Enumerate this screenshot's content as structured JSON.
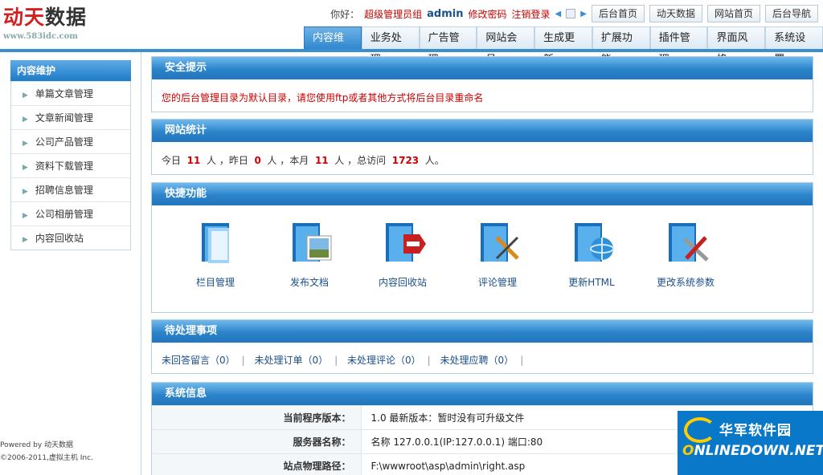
{
  "logo": {
    "text_red": "动天",
    "text_dark": "数据",
    "url": "www.583idc.com"
  },
  "topbar": {
    "greeting": "你好：",
    "role": "超级管理员组",
    "username": "admin",
    "change_password": "修改密码",
    "logout": "注销登录",
    "buttons": [
      "后台首页",
      "动天数据",
      "网站首页",
      "后台导航"
    ]
  },
  "menu": {
    "tabs": [
      "内容维护",
      "业务处理",
      "广告管理",
      "网站会员",
      "生成更新",
      "扩展功能",
      "插件管理",
      "界面风格",
      "系统设置"
    ],
    "active": "内容维护"
  },
  "sidebar": {
    "title": "内容维护",
    "items": [
      "单篇文章管理",
      "文章新闻管理",
      "公司产品管理",
      "资料下载管理",
      "招聘信息管理",
      "公司相册管理",
      "内容回收站"
    ],
    "footer_line1": "Powered by 动天数据",
    "footer_line2": "©2006-2011,虚拟主机 Inc."
  },
  "security": {
    "title": "安全提示",
    "message": "您的后台管理目录为默认目录，请您使用ftp或者其他方式将后台目录重命名"
  },
  "stats": {
    "title": "网站统计",
    "today_label": "今日",
    "today": "11",
    "yesterday_label": "人 ，昨日",
    "yesterday": "0",
    "month_label": "人 ，本月",
    "month": "11",
    "total_label": "人 ，总访问",
    "total": "1723",
    "end": "人。"
  },
  "quick": {
    "title": "快捷功能",
    "items": [
      {
        "label": "栏目管理",
        "icon": "column-folder-icon"
      },
      {
        "label": "发布文档",
        "icon": "publish-document-icon"
      },
      {
        "label": "内容回收站",
        "icon": "recycle-bin-icon"
      },
      {
        "label": "评论管理",
        "icon": "comment-edit-icon"
      },
      {
        "label": "更新HTML",
        "icon": "update-html-icon"
      },
      {
        "label": "更改系统参数",
        "icon": "system-tools-icon"
      }
    ]
  },
  "todo": {
    "title": "待处理事项",
    "items": [
      "未回答留言（0）",
      "未处理订单（0）",
      "未处理评论（0）",
      "未处理应聘（0）"
    ]
  },
  "sysinfo": {
    "title": "系统信息",
    "rows": [
      {
        "key": "当前程序版本：",
        "value": "1.0 最新版本：暂时没有可升级文件"
      },
      {
        "key": "服务器名称：",
        "value": "名称 127.0.0.1(IP:127.0.0.1) 端口:80"
      },
      {
        "key": "站点物理路径：",
        "value": "F:\\wwwroot\\asp\\admin\\right.asp"
      }
    ]
  },
  "watermark": {
    "cn": "华军软件园",
    "en_o": "O",
    "en_rest": "NLINEDOWN.NET"
  },
  "colors": {
    "accent": "#2b84ca",
    "alert": "#cc0000",
    "link": "#1a4f8c"
  }
}
